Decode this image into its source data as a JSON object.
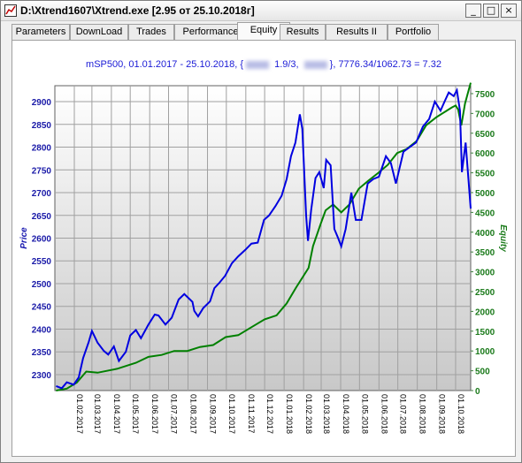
{
  "window": {
    "title": "D:\\Xtrend1607\\Xtrend.exe    [2.95 от 25.10.2018г]",
    "minimize": "_",
    "maximize": "□",
    "close": "×"
  },
  "tabs": [
    "Parameters",
    "DownLoad",
    "Trades",
    "Performance",
    "Equity",
    "Results",
    "Results II",
    "Portfolio"
  ],
  "active_tab": "Equity",
  "chart_header": {
    "prefix": "mSP500, 01.01.2017 - 25.10.2018,  {",
    "mid": " 1.9/3, ",
    "suffix": "}, 7776.34/1062.73 = 7.32"
  },
  "colors": {
    "price": "#0000e0",
    "equity": "#008000",
    "grid": "#a0a0a0"
  },
  "chart_data": {
    "type": "line",
    "ylabel": "Price",
    "y2label": "Equity",
    "ylim": [
      2265,
      2935
    ],
    "y2lim": [
      0,
      7700
    ],
    "yticks": [
      2300,
      2350,
      2400,
      2450,
      2500,
      2550,
      2600,
      2650,
      2700,
      2750,
      2800,
      2850,
      2900
    ],
    "y2ticks": [
      0,
      500,
      1000,
      1500,
      2000,
      2500,
      3000,
      3500,
      4000,
      4500,
      5000,
      5500,
      6000,
      6500,
      7000,
      7500
    ],
    "xticks": [
      "01.02.2017",
      "01.03.2017",
      "01.04.2017",
      "01.05.2017",
      "01.06.2017",
      "01.07.2017",
      "01.08.2017",
      "01.09.2017",
      "01.10.2017",
      "01.11.2017",
      "01.12.2017",
      "01.01.2018",
      "01.02.2018",
      "01.03.2018",
      "01.04.2018",
      "01.05.2018",
      "01.06.2018",
      "01.07.2018",
      "01.08.2018",
      "01.09.2018",
      "01.10.2018"
    ],
    "series": [
      {
        "name": "Price",
        "axis": "left",
        "x": [
          "2017-01-03",
          "2017-01-12",
          "2017-01-20",
          "2017-01-31",
          "2017-02-08",
          "2017-02-15",
          "2017-02-24",
          "2017-03-01",
          "2017-03-10",
          "2017-03-20",
          "2017-03-27",
          "2017-04-05",
          "2017-04-13",
          "2017-04-24",
          "2017-05-01",
          "2017-05-10",
          "2017-05-18",
          "2017-05-30",
          "2017-06-09",
          "2017-06-15",
          "2017-06-26",
          "2017-07-06",
          "2017-07-17",
          "2017-07-26",
          "2017-08-08",
          "2017-08-11",
          "2017-08-17",
          "2017-08-25",
          "2017-09-05",
          "2017-09-12",
          "2017-09-20",
          "2017-09-29",
          "2017-10-10",
          "2017-10-20",
          "2017-10-31",
          "2017-11-10",
          "2017-11-20",
          "2017-11-30",
          "2017-12-08",
          "2017-12-18",
          "2017-12-28",
          "2018-01-05",
          "2018-01-12",
          "2018-01-19",
          "2018-01-26",
          "2018-01-30",
          "2018-02-05",
          "2018-02-08",
          "2018-02-13",
          "2018-02-20",
          "2018-02-26",
          "2018-03-05",
          "2018-03-09",
          "2018-03-16",
          "2018-03-22",
          "2018-03-28",
          "2018-04-02",
          "2018-04-09",
          "2018-04-18",
          "2018-04-25",
          "2018-05-04",
          "2018-05-14",
          "2018-05-23",
          "2018-06-01",
          "2018-06-12",
          "2018-06-20",
          "2018-06-28",
          "2018-07-10",
          "2018-07-20",
          "2018-07-30",
          "2018-08-10",
          "2018-08-20",
          "2018-08-29",
          "2018-09-07",
          "2018-09-14",
          "2018-09-20",
          "2018-09-28",
          "2018-10-03",
          "2018-10-08",
          "2018-10-11",
          "2018-10-17",
          "2018-10-25"
        ],
        "values": [
          2275,
          2270,
          2283,
          2278,
          2294,
          2336,
          2372,
          2396,
          2370,
          2352,
          2344,
          2362,
          2330,
          2350,
          2386,
          2398,
          2380,
          2410,
          2432,
          2430,
          2410,
          2425,
          2465,
          2477,
          2460,
          2440,
          2428,
          2446,
          2461,
          2490,
          2502,
          2517,
          2545,
          2560,
          2574,
          2588,
          2590,
          2640,
          2650,
          2670,
          2693,
          2730,
          2780,
          2810,
          2872,
          2840,
          2650,
          2594,
          2662,
          2732,
          2745,
          2710,
          2772,
          2760,
          2620,
          2600,
          2582,
          2620,
          2700,
          2640,
          2640,
          2720,
          2730,
          2735,
          2780,
          2765,
          2720,
          2790,
          2800,
          2810,
          2845,
          2862,
          2900,
          2880,
          2902,
          2920,
          2912,
          2925,
          2880,
          2745,
          2810,
          2665
        ]
      },
      {
        "name": "Equity",
        "axis": "right",
        "x": [
          "2017-01-03",
          "2017-01-20",
          "2017-02-05",
          "2017-02-20",
          "2017-03-10",
          "2017-04-10",
          "2017-05-10",
          "2017-05-30",
          "2017-06-20",
          "2017-07-10",
          "2017-07-31",
          "2017-08-20",
          "2017-09-10",
          "2017-09-30",
          "2017-10-20",
          "2017-11-10",
          "2017-12-01",
          "2017-12-20",
          "2018-01-05",
          "2018-01-20",
          "2018-02-01",
          "2018-02-09",
          "2018-02-16",
          "2018-02-28",
          "2018-03-08",
          "2018-03-20",
          "2018-04-02",
          "2018-04-15",
          "2018-04-30",
          "2018-05-15",
          "2018-05-31",
          "2018-06-15",
          "2018-06-30",
          "2018-07-15",
          "2018-07-31",
          "2018-08-15",
          "2018-08-31",
          "2018-09-15",
          "2018-09-25",
          "2018-10-01",
          "2018-10-05",
          "2018-10-10",
          "2018-10-16",
          "2018-10-25"
        ],
        "values": [
          0,
          50,
          200,
          480,
          450,
          550,
          700,
          850,
          900,
          1000,
          1000,
          1100,
          1150,
          1350,
          1400,
          1600,
          1800,
          1900,
          2200,
          2600,
          2900,
          3100,
          3650,
          4200,
          4550,
          4700,
          4500,
          4700,
          5100,
          5300,
          5500,
          5700,
          6000,
          6100,
          6300,
          6700,
          6900,
          7050,
          7150,
          7200,
          7100,
          6700,
          7250,
          7776
        ]
      }
    ]
  }
}
